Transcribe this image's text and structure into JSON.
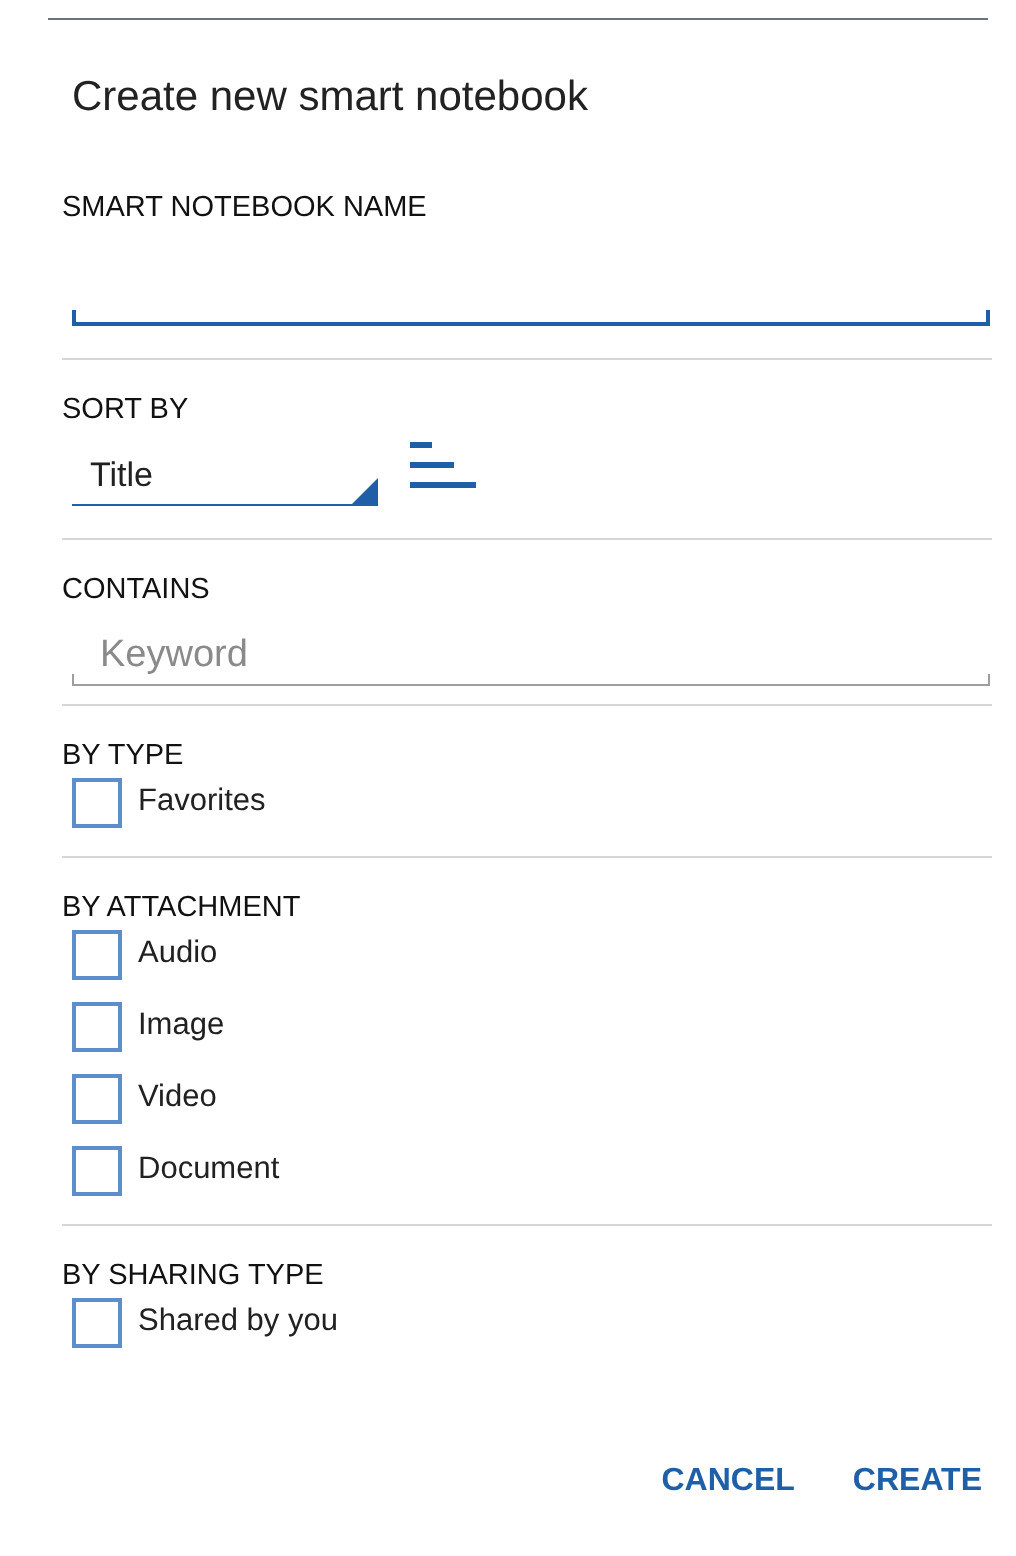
{
  "dialog": {
    "title": "Create new smart notebook"
  },
  "sections": [
    {
      "kind": "text_input",
      "label": "SMART NOTEBOOK NAME",
      "focused": true
    },
    {
      "kind": "select",
      "label": "SORT BY",
      "value": "Title"
    },
    {
      "kind": "text_input",
      "label": "CONTAINS",
      "placeholder": "Keyword",
      "focused": false
    },
    {
      "kind": "checkboxes",
      "label": "BY TYPE",
      "options": [
        {
          "label": "Favorites",
          "checked": false
        }
      ]
    },
    {
      "kind": "checkboxes",
      "label": "BY ATTACHMENT",
      "options": [
        {
          "label": "Audio",
          "checked": false
        },
        {
          "label": "Image",
          "checked": false
        },
        {
          "label": "Video",
          "checked": false
        },
        {
          "label": "Document",
          "checked": false
        }
      ]
    },
    {
      "kind": "checkboxes",
      "label": "BY SHARING TYPE",
      "options": [
        {
          "label": "Shared by you",
          "checked": false
        }
      ]
    }
  ],
  "buttons": [
    "CANCEL",
    "CREATE"
  ]
}
